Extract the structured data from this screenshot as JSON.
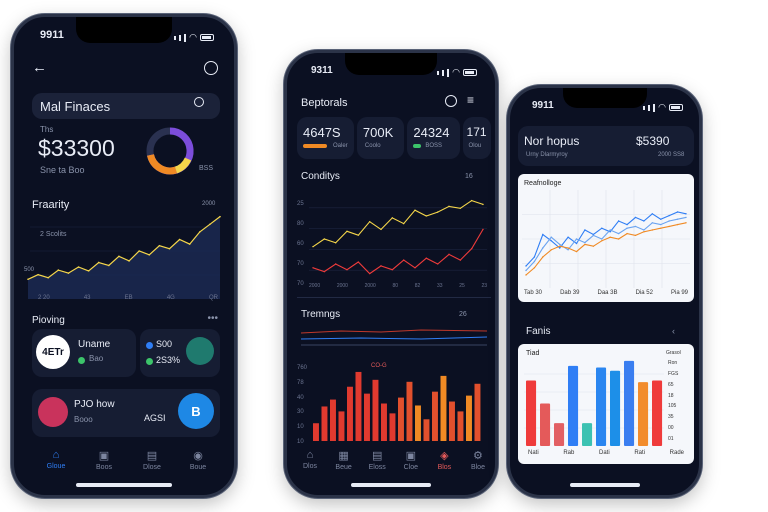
{
  "phone1": {
    "time": "9911",
    "header_title": "Mal Finaces",
    "balance_label": "Ths",
    "balance": "$33300",
    "balance_sub": "Sne ta Boo",
    "ring_label": "BSS",
    "section_title": "Fraarity",
    "chart_label": "2 Scolits",
    "axis_left": "500",
    "axis_right": "2000",
    "x_ticks": [
      "2 20",
      "43",
      "EB",
      "4G",
      "QR"
    ],
    "funding_title": "Pioving",
    "card1_circle": "4ETr",
    "card1_title": "Uname",
    "card1_sub": "Bao",
    "card2_line1": "S00",
    "card2_line2": "2S3%",
    "card3_title": "PJO how",
    "card3_sub": "Booo",
    "card3_value": "AGSI",
    "card3_badge": "B",
    "tabs": [
      "Gloue",
      "Boos",
      "Dlose",
      "Boue"
    ],
    "colors": {
      "accent": "#f5d64a",
      "ring_orange": "#f08a24",
      "ring_purple": "#7c4ddb",
      "badge_blue": "#1e88e5",
      "badge_teal": "#1f7a6e"
    }
  },
  "phone2": {
    "time": "9311",
    "header_title": "Beptorals",
    "stats": [
      {
        "value": "4647S",
        "label": "Oaler"
      },
      {
        "value": "700K",
        "label": "Coolo"
      },
      {
        "value": "24324",
        "label": "BOSS"
      },
      {
        "value": "171",
        "label": "Olou"
      }
    ],
    "chart_title": "Conditys",
    "chart_badge": "16",
    "axis_labels": [
      "25",
      "80",
      "60",
      "70",
      "70"
    ],
    "x_ticks": [
      "2000",
      "2000",
      "2000",
      "80",
      "82",
      "33",
      "25",
      "23"
    ],
    "trends_title": "Tremngs",
    "trends_badge": "26",
    "bars_label": "CO-G",
    "bars_axis": [
      "760",
      "78",
      "40",
      "30",
      "10",
      "10"
    ],
    "tabs": [
      "Dlos",
      "Beue",
      "Eloss",
      "Cloe",
      "Blos",
      "Bloe"
    ]
  },
  "phone3": {
    "time": "9911",
    "header_title": "Nor hopus",
    "header_value": "$5390",
    "header_sub": "Urny Dlarmyroy",
    "header_sub2": "2000 SS8",
    "line_title": "Reafnolloge",
    "line_x": [
      "Tab 30",
      "Dab 39",
      "Daa 3B",
      "Dia 52",
      "Pia 99"
    ],
    "bars_title": "Fanis",
    "bars_label": "Tiad",
    "bars_legend": "Grasol",
    "bars_axis": [
      "Ron",
      "FGS",
      "65",
      "18",
      "105",
      "35",
      "00",
      "01"
    ],
    "bars_x": [
      "Nati",
      "Rab",
      "Dati",
      "Rati",
      "Rade"
    ]
  },
  "chart_data": [
    {
      "type": "area",
      "title": "Fraarity",
      "series": [
        {
          "values": [
            18,
            24,
            20,
            30,
            26,
            34,
            29,
            40,
            36,
            48,
            42,
            55,
            50,
            62,
            58,
            70,
            64,
            80,
            90,
            100
          ]
        }
      ]
    },
    {
      "type": "line",
      "title": "Conditys",
      "series": [
        {
          "values": [
            42,
            50,
            46,
            58,
            54,
            68,
            60,
            72,
            66,
            80,
            74,
            78,
            84,
            82,
            90,
            86
          ]
        },
        {
          "values": [
            20,
            16,
            24,
            18,
            26,
            14,
            22,
            18,
            28,
            20,
            30,
            24,
            34,
            28,
            40,
            60
          ]
        }
      ]
    },
    {
      "type": "bar",
      "title": "Tremngs",
      "values": [
        18,
        35,
        42,
        30,
        55,
        70,
        48,
        62,
        38,
        28,
        44,
        60,
        36,
        22,
        50,
        66,
        40,
        30,
        46,
        58
      ]
    },
    {
      "type": "line",
      "title": "Reafnolloge",
      "series": [
        {
          "values": [
            20,
            30,
            55,
            48,
            40,
            52,
            45,
            60,
            55,
            62,
            58,
            70,
            66,
            74,
            70,
            78,
            72,
            76,
            80,
            78
          ]
        },
        {
          "values": [
            15,
            25,
            40,
            52,
            44,
            38,
            50,
            46,
            54,
            50,
            60,
            56,
            62,
            64,
            60,
            68,
            66,
            70,
            72,
            74
          ]
        },
        {
          "values": [
            10,
            18,
            30,
            38,
            42,
            40,
            36,
            44,
            42,
            48,
            52,
            50,
            56,
            54,
            58,
            60,
            62,
            64,
            66,
            68
          ]
        }
      ]
    },
    {
      "type": "bar",
      "title": "Fanis",
      "values": [
        80,
        52,
        28,
        98,
        28,
        96,
        92,
        104,
        78,
        80
      ],
      "colors": [
        "#ef3b3b",
        "#e45a5a",
        "#e25f63",
        "#2f7ef5",
        "#3cc2b2",
        "#2a86f0",
        "#1d8fe8",
        "#3a7ef0",
        "#f28c2c",
        "#ef3b3b"
      ]
    }
  ]
}
